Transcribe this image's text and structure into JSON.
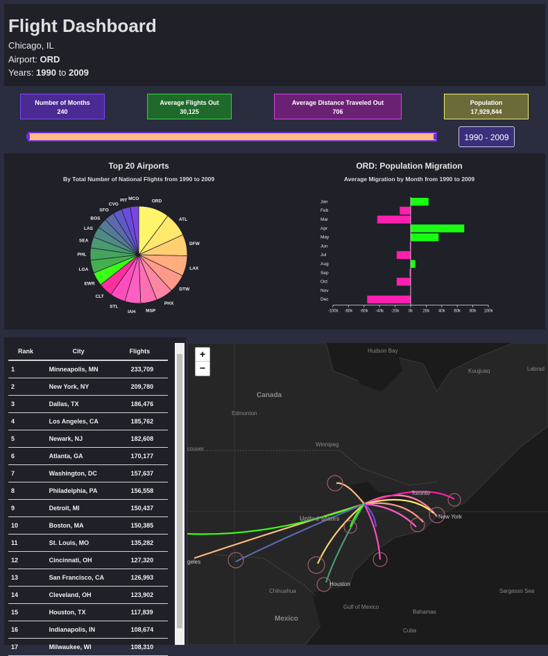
{
  "header": {
    "title": "Flight Dashboard",
    "location": "Chicago, IL",
    "airport_label": "Airport:",
    "airport_code": "ORD",
    "years_label": "Years:",
    "year_start": "1990",
    "year_to": "to",
    "year_end": "2009"
  },
  "stats": [
    {
      "label": "Number of Months",
      "value": "240",
      "bg": "#4b2a93",
      "border": "#7d46ff"
    },
    {
      "label": "Average Flights Out",
      "value": "30,125",
      "bg": "#1f6a2a",
      "border": "#34d04a"
    },
    {
      "label": "Average Distance Traveled Out",
      "value": "706",
      "bg": "#6b2173",
      "border": "#d246e6"
    },
    {
      "label": "Population",
      "value": "17,929,844",
      "bg": "#6b6b3a",
      "border": "#f0f06e"
    }
  ],
  "range_button": "1990 - 2009",
  "colors": {
    "slider_fill": "#ffbb82",
    "slider_border": "#6b2fd6"
  },
  "pie": {
    "title": "Top 20 Airports",
    "subtitle_pre": "By Total Number of National Flights from",
    "subtitle_start": "1990",
    "subtitle_to": "to",
    "subtitle_end": "2009"
  },
  "migration": {
    "title_code": "ORD",
    "title_rest": ": Population Migration",
    "subtitle_pre": "Average Migration by Month from",
    "subtitle_start": "1990",
    "subtitle_to": "to",
    "subtitle_end": "2009"
  },
  "chart_data": [
    {
      "type": "pie",
      "categories": [
        "ORD",
        "ATL",
        "DFW",
        "LAX",
        "DTW",
        "PHX",
        "MSP",
        "IAH",
        "STL",
        "CLT",
        "EWR",
        "LGA",
        "PHL",
        "SEA",
        "LAS",
        "BOS",
        "SFO",
        "CVG",
        "PIT",
        "MCO"
      ],
      "values": [
        10.5,
        8.2,
        7.3,
        6.9,
        6.3,
        5.8,
        5.6,
        5.4,
        5.2,
        4.8,
        4.6,
        4.4,
        4.2,
        3.8,
        3.6,
        3.5,
        3.4,
        3.1,
        3.0,
        2.9
      ],
      "colors": [
        "#fff56a",
        "#ffe86c",
        "#ffcf72",
        "#ffac7e",
        "#ff9a8a",
        "#ff86a2",
        "#ff6fb2",
        "#ff5ec4",
        "#ff4ebc",
        "#fe30a0",
        "#39ff14",
        "#42b04e",
        "#45a35d",
        "#4a9a72",
        "#4f8a85",
        "#547a95",
        "#5a6aad",
        "#5f5ac8",
        "#6a4cdc",
        "#7a45e6"
      ],
      "title": "Top 20 Airports"
    },
    {
      "type": "bar",
      "orientation": "horizontal",
      "categories": [
        "Jan",
        "Feb",
        "Mar",
        "Apr",
        "May",
        "Jun",
        "Jul",
        "Aug",
        "Sep",
        "Oct",
        "Nov",
        "Dec"
      ],
      "values": [
        23000,
        -14000,
        -43000,
        69000,
        36000,
        -1000,
        -18000,
        6000,
        -1500,
        -18000,
        -500,
        -56000
      ],
      "xlim": [
        -100000,
        100000
      ],
      "x_ticks": [
        "-100k",
        "-80k",
        "-60k",
        "-40k",
        "-20k",
        "0k",
        "20k",
        "40k",
        "60k",
        "80k",
        "100k"
      ],
      "positive_color": "#19ff14",
      "negative_color": "#ff1fae",
      "title": "ORD: Population Migration"
    }
  ],
  "table": {
    "headers": [
      "Rank",
      "City",
      "Flights"
    ],
    "rows": [
      [
        "1",
        "Minneapolis, MN",
        "233,709"
      ],
      [
        "2",
        "New York, NY",
        "209,780"
      ],
      [
        "3",
        "Dallas, TX",
        "186,476"
      ],
      [
        "4",
        "Los Angeles, CA",
        "185,762"
      ],
      [
        "5",
        "Newark, NJ",
        "182,608"
      ],
      [
        "6",
        "Atlanta, GA",
        "170,177"
      ],
      [
        "7",
        "Washington, DC",
        "157,637"
      ],
      [
        "8",
        "Philadelphia, PA",
        "156,558"
      ],
      [
        "9",
        "Detroit, MI",
        "150,437"
      ],
      [
        "10",
        "Boston, MA",
        "150,385"
      ],
      [
        "11",
        "St. Louis, MO",
        "135,282"
      ],
      [
        "12",
        "Cincinnati, OH",
        "127,320"
      ],
      [
        "13",
        "San Francisco, CA",
        "126,993"
      ],
      [
        "14",
        "Cleveland, OH",
        "123,902"
      ],
      [
        "15",
        "Houston, TX",
        "117,839"
      ],
      [
        "16",
        "Indianapolis, IN",
        "108,674"
      ],
      [
        "17",
        "Milwaukee, WI",
        "108,310"
      ]
    ]
  },
  "map": {
    "zoom_in": "+",
    "zoom_out": "−",
    "labels": [
      "Hudson Bay",
      "Canada",
      "Edmonton",
      "Winnipeg",
      "Kuujjuaq",
      "Labrad",
      "couver",
      "United States",
      "Toronto",
      "New York",
      "Houston",
      "Chihuahua",
      "Gulf of Mexico",
      "Mexico",
      "Bahamas",
      "Cuba",
      "Sargasso Sea",
      "geles"
    ]
  }
}
